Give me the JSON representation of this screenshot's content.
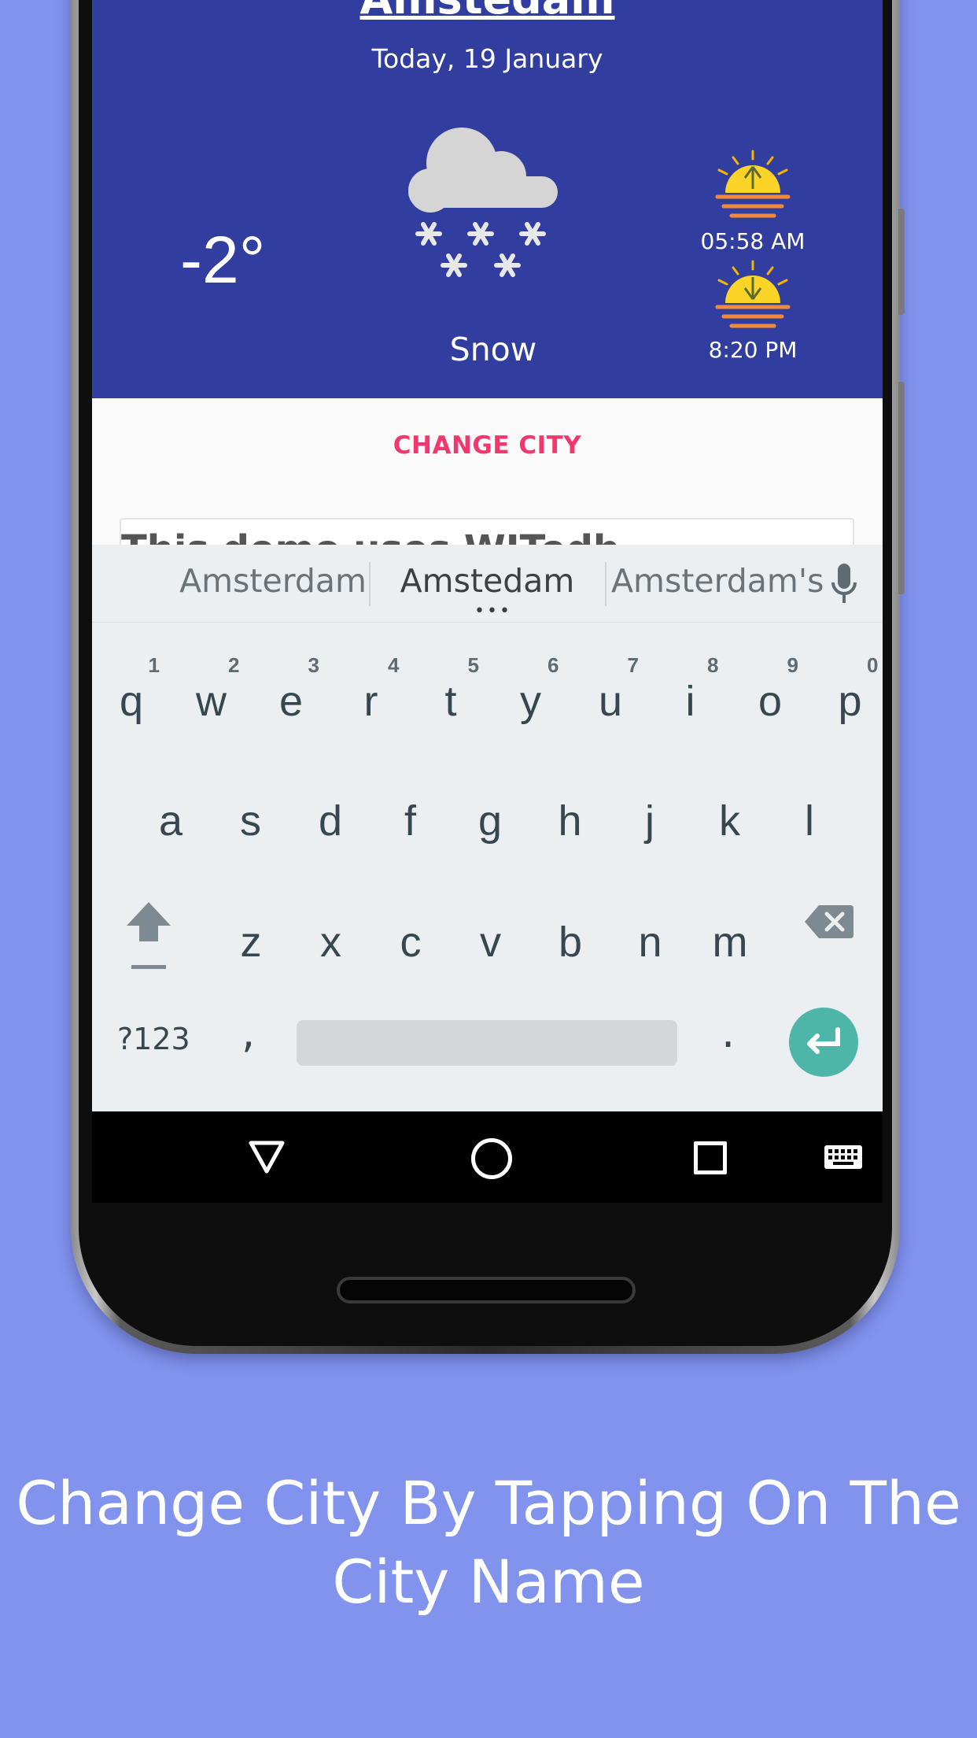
{
  "weather": {
    "city": "Amstedam",
    "date": "Today, 19 January",
    "temperature": "-2°",
    "condition": "Snow",
    "condition_icon": "snow-cloud-icon",
    "sunrise": "05:58 AM",
    "sunset": "8:20 PM",
    "panel_color": "#313e9f"
  },
  "actions": {
    "change_city": "CHANGE CITY",
    "accent_color": "#f1386e"
  },
  "input": {
    "text": "This demo uses WITedh"
  },
  "keyboard": {
    "suggestions": [
      "Amsterdam",
      "Amstedam",
      "Amsterdam's"
    ],
    "row1": [
      {
        "key": "q",
        "hint": "1"
      },
      {
        "key": "w",
        "hint": "2"
      },
      {
        "key": "e",
        "hint": "3"
      },
      {
        "key": "r",
        "hint": "4"
      },
      {
        "key": "t",
        "hint": "5"
      },
      {
        "key": "y",
        "hint": "6"
      },
      {
        "key": "u",
        "hint": "7"
      },
      {
        "key": "i",
        "hint": "8"
      },
      {
        "key": "o",
        "hint": "9"
      },
      {
        "key": "p",
        "hint": "0"
      }
    ],
    "row2": [
      "a",
      "s",
      "d",
      "f",
      "g",
      "h",
      "j",
      "k",
      "l"
    ],
    "row3": [
      "z",
      "x",
      "c",
      "v",
      "b",
      "n",
      "m"
    ],
    "symbols_label": "?123",
    "comma": ",",
    "period": ".",
    "enter_color": "#4db6a9"
  },
  "caption": {
    "line1": "Change City By Tapping On The",
    "line2": "City Name"
  },
  "background_color": "#8293ee"
}
